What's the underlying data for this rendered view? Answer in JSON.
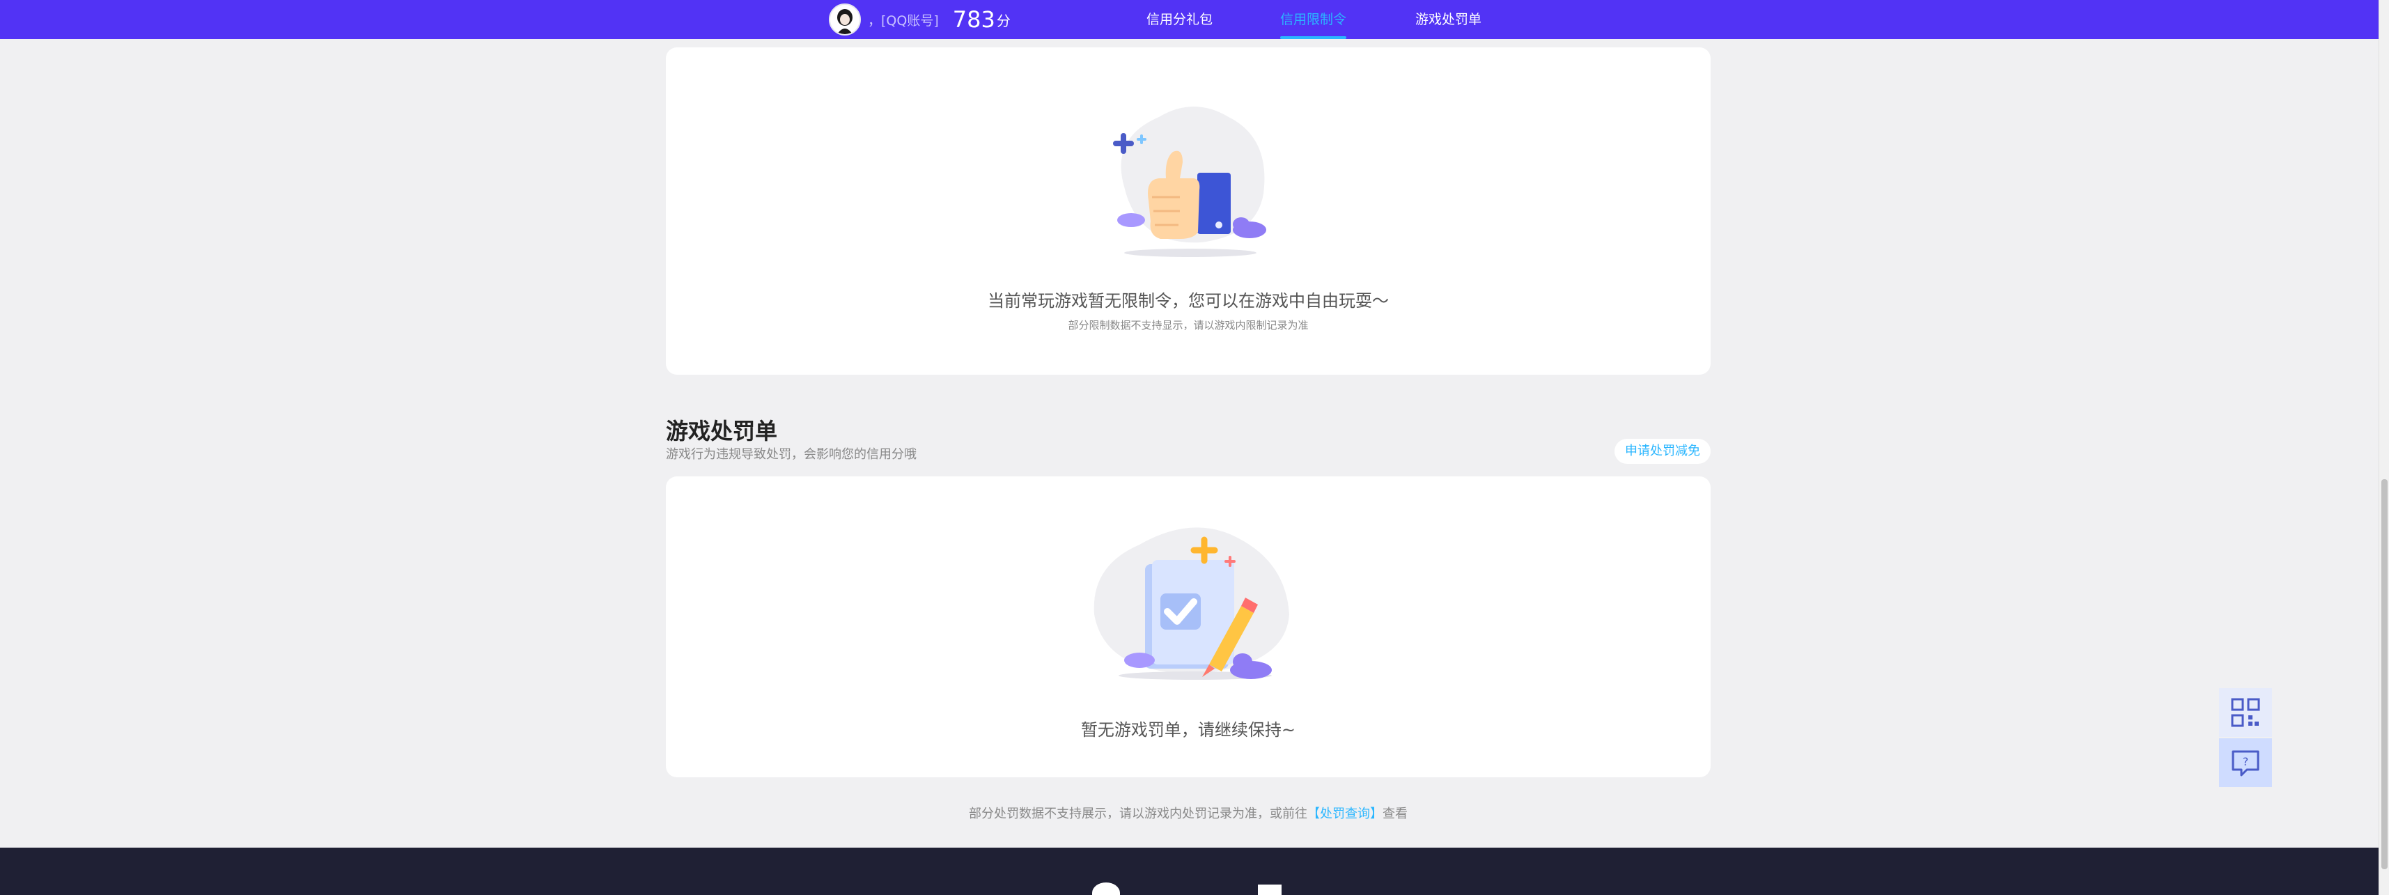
{
  "header": {
    "account": "，[QQ账号]",
    "score": "783",
    "score_unit": "分",
    "tabs": [
      {
        "label": "信用分礼包",
        "active": false
      },
      {
        "label": "信用限制令",
        "active": true
      },
      {
        "label": "游戏处罚单",
        "active": false
      }
    ]
  },
  "restriction": {
    "empty_title": "当前常玩游戏暂无限制令，您可以在游戏中自由玩耍～",
    "empty_sub": "部分限制数据不支持显示，请以游戏内限制记录为准"
  },
  "penalty": {
    "title": "游戏处罚单",
    "desc": "游戏行为违规导致处罚，会影响您的信用分哦",
    "appeal_label": "申请处罚减免",
    "empty_title": "暂无游戏罚单，请继续保持~"
  },
  "footnote": {
    "prefix": "部分处罚数据不支持展示，请以游戏内处罚记录为准，或前往",
    "link": "【处罚查询】",
    "suffix": "查看"
  },
  "colors": {
    "brand": "#5233f5",
    "accent": "#2ab6ff",
    "footer": "#1f2034"
  },
  "icons": {
    "qr": "qr-code-icon",
    "feedback": "feedback-icon"
  }
}
